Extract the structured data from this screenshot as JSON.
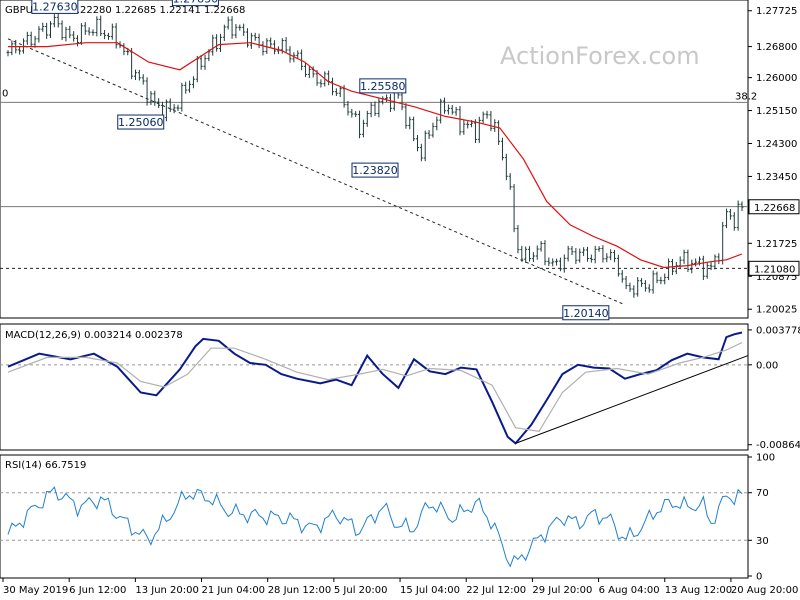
{
  "chart_data": [
    {
      "type": "candlestick",
      "title": "GBPUSD, H4  1.22280 1.22685 1.22141 1.22668",
      "watermark": "ActionForex.com",
      "ylim": [
        1.1985,
        1.2795
      ],
      "yticks": [
        "1.27725",
        "1.26800",
        "1.26000",
        "1.25150",
        "1.24300",
        "1.23450",
        "1.21725",
        "1.20875",
        "1.20025"
      ],
      "x_ticks": [
        "30 May 2019",
        "6 Jun 12:00",
        "13 Jun 20:00",
        "21 Jun 04:00",
        "28 Jun 12:00",
        "5 Jul 20:00",
        "15 Jul 04:00",
        "22 Jul 12:00",
        "29 Jul 20:00",
        "6 Aug 04:00",
        "13 Aug 12:00",
        "20 Aug 20:00"
      ],
      "close_path": [
        [
          0,
          1.2665
        ],
        [
          3,
          1.27
        ],
        [
          6,
          1.2745
        ],
        [
          8,
          1.27
        ],
        [
          11,
          1.273
        ],
        [
          14,
          1.27
        ],
        [
          16,
          1.262
        ],
        [
          19,
          1.2525
        ],
        [
          21,
          1.2515
        ],
        [
          23,
          1.258
        ],
        [
          25,
          1.265
        ],
        [
          27,
          1.27
        ],
        [
          28,
          1.2735
        ],
        [
          29,
          1.273
        ],
        [
          31,
          1.27
        ],
        [
          33,
          1.268
        ],
        [
          35,
          1.268
        ],
        [
          37,
          1.265
        ],
        [
          39,
          1.26
        ],
        [
          41,
          1.259
        ],
        [
          43,
          1.254
        ],
        [
          45,
          1.247
        ],
        [
          47,
          1.253
        ],
        [
          49,
          1.2545
        ],
        [
          50,
          1.255
        ],
        [
          52,
          1.244
        ],
        [
          53,
          1.2405
        ],
        [
          54,
          1.2465
        ],
        [
          56,
          1.2535
        ],
        [
          58,
          1.248
        ],
        [
          60,
          1.2465
        ],
        [
          61,
          1.2505
        ],
        [
          62,
          1.249
        ],
        [
          64,
          1.235
        ],
        [
          65,
          1.218
        ],
        [
          66,
          1.213
        ],
        [
          68,
          1.216
        ],
        [
          70,
          1.211
        ],
        [
          72,
          1.215
        ],
        [
          74,
          1.214
        ],
        [
          76,
          1.215
        ],
        [
          78,
          1.2125
        ],
        [
          79,
          1.205
        ],
        [
          80,
          1.206
        ],
        [
          82,
          1.2065
        ],
        [
          84,
          1.209
        ],
        [
          86,
          1.213
        ],
        [
          88,
          1.212
        ],
        [
          90,
          1.2105
        ],
        [
          91,
          1.215
        ],
        [
          92,
          1.225
        ],
        [
          93,
          1.2235
        ],
        [
          94,
          1.2267
        ]
      ],
      "ma": {
        "color": "#e01010",
        "points": [
          [
            0,
            1.268
          ],
          [
            5,
            1.268
          ],
          [
            10,
            1.269
          ],
          [
            14,
            1.269
          ],
          [
            18,
            1.264
          ],
          [
            22,
            1.262
          ],
          [
            27,
            1.2685
          ],
          [
            31,
            1.269
          ],
          [
            35,
            1.267
          ],
          [
            38,
            1.264
          ],
          [
            41,
            1.259
          ],
          [
            44,
            1.2565
          ],
          [
            48,
            1.2545
          ],
          [
            52,
            1.2525
          ],
          [
            56,
            1.25
          ],
          [
            60,
            1.2485
          ],
          [
            63,
            1.247
          ],
          [
            66,
            1.239
          ],
          [
            69,
            1.228
          ],
          [
            72,
            1.222
          ],
          [
            75,
            1.219
          ],
          [
            78,
            1.2165
          ],
          [
            81,
            1.213
          ],
          [
            84,
            1.211
          ],
          [
            87,
            1.2115
          ],
          [
            90,
            1.2125
          ],
          [
            92,
            1.213
          ],
          [
            94,
            1.2145
          ]
        ]
      },
      "dashed_trendline": [
        [
          0,
          1.27
        ],
        [
          79,
          1.2014
        ]
      ],
      "horizontal_lines": [
        {
          "value": 1.2536,
          "style": "solid",
          "right_label": "38.2",
          "left_label": "0"
        },
        {
          "value": 1.2267,
          "style": "solid"
        },
        {
          "value": 1.2108,
          "style": "dashed",
          "tag": "1.21080"
        }
      ],
      "current_price_tag": "1.22668",
      "annotations": [
        {
          "text": "1.27630",
          "x": 6,
          "value": 1.2763,
          "pos": "above"
        },
        {
          "text": "1.27830",
          "x": 24,
          "value": 1.2783,
          "pos": "above"
        },
        {
          "text": "1.25060",
          "x": 17,
          "value": 1.2506,
          "pos": "below"
        },
        {
          "text": "1.25580",
          "x": 48,
          "value": 1.2558,
          "pos": "above"
        },
        {
          "text": "1.23820",
          "x": 47,
          "value": 1.2382,
          "pos": "below"
        },
        {
          "text": "1.20140",
          "x": 74,
          "value": 1.2014,
          "pos": "below"
        }
      ]
    },
    {
      "type": "line",
      "title": "MACD(12,26,9) 0.003214 0.002378",
      "ylim": [
        -0.009,
        0.0042
      ],
      "yticks": [
        "0.003778",
        "0.00",
        "-0.008646"
      ],
      "series": [
        {
          "name": "MACD",
          "color": "#0a1a8a",
          "points": [
            [
              0,
              -0.0002
            ],
            [
              4,
              0.0012
            ],
            [
              8,
              0.0006
            ],
            [
              11,
              0.0012
            ],
            [
              14,
              -0.0002
            ],
            [
              17,
              -0.003
            ],
            [
              19,
              -0.0033
            ],
            [
              22,
              -0.0005
            ],
            [
              24,
              0.002
            ],
            [
              25,
              0.0028
            ],
            [
              27,
              0.0026
            ],
            [
              29,
              0.0012
            ],
            [
              31,
              0.0002
            ],
            [
              33,
              0.0
            ],
            [
              35,
              -0.001
            ],
            [
              37,
              -0.0015
            ],
            [
              40,
              -0.002
            ],
            [
              42,
              -0.0016
            ],
            [
              44,
              -0.0022
            ],
            [
              46,
              0.001
            ],
            [
              48,
              -0.001
            ],
            [
              50,
              -0.0025
            ],
            [
              52,
              0.0006
            ],
            [
              54,
              -0.0007
            ],
            [
              56,
              -0.001
            ],
            [
              58,
              -0.0003
            ],
            [
              60,
              -0.0005
            ],
            [
              62,
              -0.004
            ],
            [
              64,
              -0.0078
            ],
            [
              65,
              -0.0085
            ],
            [
              67,
              -0.0065
            ],
            [
              69,
              -0.0038
            ],
            [
              71,
              -0.001
            ],
            [
              73,
              0.0
            ],
            [
              75,
              -0.0003
            ],
            [
              77,
              -0.0004
            ],
            [
              79,
              -0.0015
            ],
            [
              81,
              -0.001
            ],
            [
              83,
              -0.0006
            ],
            [
              85,
              0.0005
            ],
            [
              87,
              0.0012
            ],
            [
              89,
              0.0008
            ],
            [
              91,
              0.0006
            ],
            [
              92,
              0.003
            ],
            [
              93,
              0.0033
            ],
            [
              94,
              0.0035
            ]
          ]
        },
        {
          "name": "Signal",
          "color": "#b0b0b0",
          "points": [
            [
              0,
              -0.0008
            ],
            [
              5,
              0.0008
            ],
            [
              10,
              0.0008
            ],
            [
              14,
              0.0002
            ],
            [
              17,
              -0.0018
            ],
            [
              20,
              -0.0024
            ],
            [
              23,
              -0.001
            ],
            [
              26,
              0.0018
            ],
            [
              29,
              0.0018
            ],
            [
              33,
              0.0006
            ],
            [
              37,
              -0.0008
            ],
            [
              41,
              -0.0016
            ],
            [
              45,
              -0.001
            ],
            [
              48,
              -0.0005
            ],
            [
              51,
              -0.0012
            ],
            [
              54,
              -0.0004
            ],
            [
              58,
              -0.0006
            ],
            [
              62,
              -0.0022
            ],
            [
              65,
              -0.0068
            ],
            [
              68,
              -0.0072
            ],
            [
              71,
              -0.003
            ],
            [
              74,
              -0.0008
            ],
            [
              78,
              -0.0004
            ],
            [
              82,
              -0.001
            ],
            [
              86,
              0.0002
            ],
            [
              89,
              0.0008
            ],
            [
              92,
              0.0016
            ],
            [
              94,
              0.0024
            ]
          ]
        }
      ],
      "trendline": [
        [
          65,
          -0.0085
        ],
        [
          94,
          0.001
        ]
      ]
    },
    {
      "type": "line",
      "title": "RSI(14) 66.7519",
      "ylim": [
        0,
        100
      ],
      "yticks": [
        100,
        70,
        30,
        0
      ],
      "levels": [
        70,
        30
      ],
      "series": [
        {
          "name": "RSI",
          "color": "#2080d0",
          "points": [
            [
              0,
              35
            ],
            [
              3,
              55
            ],
            [
              6,
              72
            ],
            [
              9,
              58
            ],
            [
              12,
              65
            ],
            [
              15,
              45
            ],
            [
              18,
              30
            ],
            [
              20,
              45
            ],
            [
              23,
              70
            ],
            [
              26,
              65
            ],
            [
              28,
              55
            ],
            [
              30,
              52
            ],
            [
              33,
              50
            ],
            [
              36,
              48
            ],
            [
              39,
              40
            ],
            [
              42,
              52
            ],
            [
              45,
              38
            ],
            [
              48,
              58
            ],
            [
              50,
              42
            ],
            [
              52,
              40
            ],
            [
              54,
              62
            ],
            [
              57,
              48
            ],
            [
              60,
              62
            ],
            [
              62,
              45
            ],
            [
              64,
              15
            ],
            [
              65,
              10
            ],
            [
              67,
              25
            ],
            [
              69,
              38
            ],
            [
              71,
              50
            ],
            [
              73,
              44
            ],
            [
              75,
              52
            ],
            [
              77,
              48
            ],
            [
              79,
              30
            ],
            [
              81,
              40
            ],
            [
              83,
              55
            ],
            [
              85,
              62
            ],
            [
              87,
              58
            ],
            [
              89,
              60
            ],
            [
              90,
              45
            ],
            [
              91,
              55
            ],
            [
              92,
              68
            ],
            [
              93,
              66
            ],
            [
              94,
              67
            ]
          ]
        }
      ]
    }
  ]
}
